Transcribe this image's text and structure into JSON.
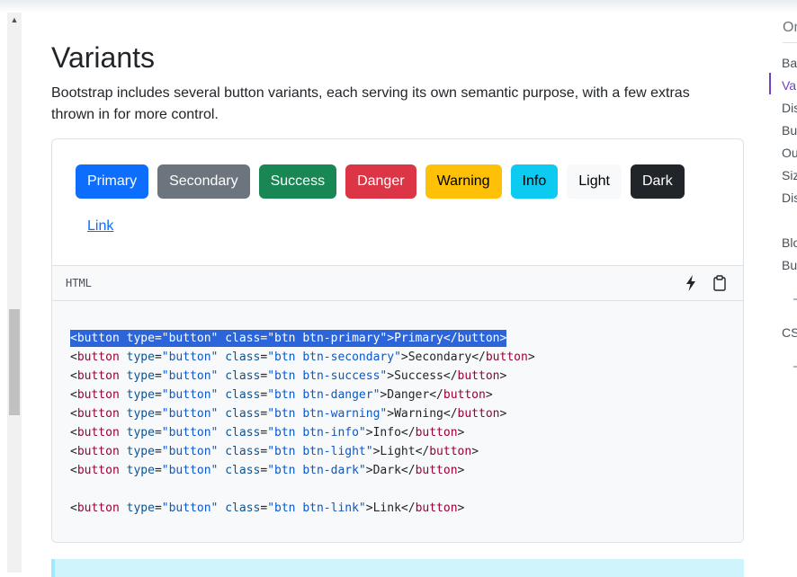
{
  "page": {
    "title": "Variants",
    "lead": "Bootstrap includes several button variants, each serving its own semantic purpose, with a few extras thrown in for more control."
  },
  "demo": {
    "buttons": [
      {
        "label": "Primary",
        "variant": "primary"
      },
      {
        "label": "Secondary",
        "variant": "secondary"
      },
      {
        "label": "Success",
        "variant": "success"
      },
      {
        "label": "Danger",
        "variant": "danger"
      },
      {
        "label": "Warning",
        "variant": "warning"
      },
      {
        "label": "Info",
        "variant": "info"
      },
      {
        "label": "Light",
        "variant": "light"
      },
      {
        "label": "Dark",
        "variant": "dark"
      },
      {
        "label": "Link",
        "variant": "link"
      }
    ]
  },
  "codebar": {
    "label": "HTML",
    "icons": [
      "lightning-icon",
      "clipboard-icon"
    ]
  },
  "code": {
    "lines": [
      {
        "cls": "btn btn-primary",
        "text": "Primary",
        "selected": true
      },
      {
        "cls": "btn btn-secondary",
        "text": "Secondary"
      },
      {
        "cls": "btn btn-success",
        "text": "Success"
      },
      {
        "cls": "btn btn-danger",
        "text": "Danger"
      },
      {
        "cls": "btn btn-warning",
        "text": "Warning"
      },
      {
        "cls": "btn btn-info",
        "text": "Info"
      },
      {
        "cls": "btn btn-light",
        "text": "Light"
      },
      {
        "cls": "btn btn-dark",
        "text": "Dark"
      },
      {
        "blank": true
      },
      {
        "cls": "btn btn-link",
        "text": "Link"
      }
    ]
  },
  "toc": {
    "title": "On",
    "items": [
      {
        "label": "Ba",
        "active": false
      },
      {
        "label": "Var",
        "active": true
      },
      {
        "label": "Dis",
        "active": false
      },
      {
        "label": "Bu",
        "active": false
      },
      {
        "label": "Ou",
        "active": false
      },
      {
        "label": "Siz",
        "active": false
      },
      {
        "label": "Dis",
        "active": false
      },
      {
        "label": "Blo",
        "active": false
      },
      {
        "label": "Bu",
        "active": false
      },
      {
        "label": "CS",
        "active": false
      }
    ]
  },
  "colors": {
    "primary": "#0d6efd",
    "secondary": "#6c757d",
    "success": "#198754",
    "danger": "#dc3545",
    "warning": "#ffc107",
    "info": "#0dcaf0",
    "light": "#f8f9fa",
    "dark": "#212529",
    "selection": "#2b65d9",
    "toc_active": "#6f42c1"
  }
}
